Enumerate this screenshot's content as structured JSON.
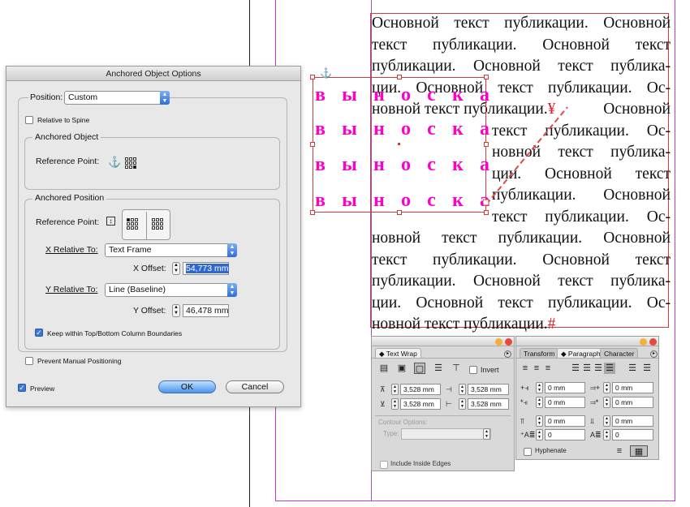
{
  "colors": {
    "guide_magenta": "#c03ac8",
    "frame_red": "#d23b3b",
    "anchored_text": "#ff00c8",
    "accent_blue": "#3d77d6"
  },
  "body_text": {
    "lines": [
      "Основной текст публикации. Основной",
      "текст публикации. Основной текст",
      "публикации. Основной текст публика-",
      "ции. Основной текст публикации. Ос-",
      "новной текст публикации.",
      "Основной",
      "текст публикации. Ос-",
      "новной текст публика-",
      "ции. Основной текст",
      "публикации. Основной",
      "текст публикации. Ос-",
      "новной текст публикации. Основной",
      "текст публикации. Основной текст",
      "публикации. Основной текст публика-",
      "ции. Основной текст публикации. Ос-",
      "новной текст публикации."
    ],
    "end_mark": "#",
    "anchor_mark": "¥"
  },
  "anchored_text": {
    "rows": [
      [
        "в",
        "ы",
        "н",
        "о",
        "с",
        "к",
        "а"
      ],
      [
        "в",
        "ы",
        "н",
        "о",
        "с",
        "к",
        "а"
      ],
      [
        "в",
        "ы",
        "н",
        "о",
        "с",
        "к",
        "а"
      ],
      [
        "в",
        "ы",
        "н",
        "о",
        "с",
        "к",
        "а"
      ]
    ]
  },
  "dialog": {
    "title": "Anchored Object Options",
    "position_label": "Position:",
    "position_value": "Custom",
    "relative_to_spine": "Relative to Spine",
    "anchored_object": {
      "title": "Anchored Object",
      "ref_point_label": "Reference Point:",
      "anchor_icon": "⚓"
    },
    "anchored_position": {
      "title": "Anchored Position",
      "ref_point_label": "Reference Point:",
      "x_relative_label": "X Relative To:",
      "x_relative_value": "Text Frame",
      "x_offset_label": "X Offset:",
      "x_offset_value": "54,773 mm",
      "y_relative_label": "Y Relative To:",
      "y_relative_value": "Line (Baseline)",
      "y_offset_label": "Y Offset:",
      "y_offset_value": "46,478 mm",
      "keep_within": "Keep within Top/Bottom Column Boundaries",
      "keep_within_checked": true
    },
    "prevent_manual": "Prevent Manual Positioning",
    "preview": "Preview",
    "preview_checked": true,
    "ok": "OK",
    "cancel": "Cancel"
  },
  "text_wrap_panel": {
    "tab": "Text Wrap",
    "invert": "Invert",
    "top_offset": "3,528 mm",
    "left_offset": "3,528 mm",
    "bottom_offset": "3,528 mm",
    "right_offset": "3,528 mm",
    "contour_options": "Contour Options:",
    "type_label": "Type:",
    "include_inside_edges": "Include Inside Edges"
  },
  "paragraph_panel": {
    "tabs": [
      "Transform",
      "Paragraph",
      "Character"
    ],
    "left_indent": "0 mm",
    "right_indent": "0 mm",
    "first_line_indent": "0 mm",
    "last_line_indent": "0 mm",
    "space_before": "0 mm",
    "space_after": "0 mm",
    "drop_cap_lines": "0",
    "drop_cap_chars": "0",
    "hyphenate": "Hyphenate"
  }
}
